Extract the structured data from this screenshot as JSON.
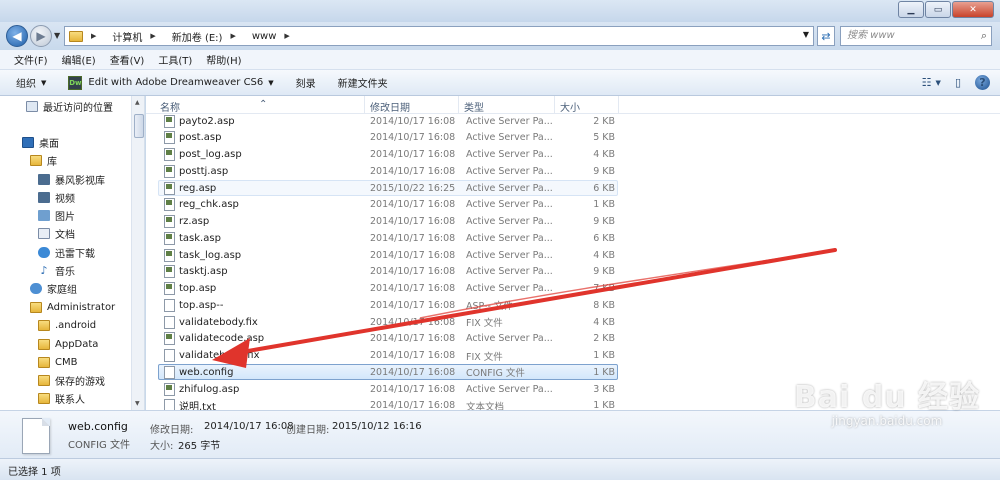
{
  "window": {
    "minimize_glyph": "▁",
    "maximize_glyph": "▭",
    "close_glyph": "✕"
  },
  "address": {
    "crumbs": [
      "计算机",
      "新加卷 (E:)",
      "www"
    ],
    "search_placeholder": "搜索 www"
  },
  "menu": [
    "文件(F)",
    "编辑(E)",
    "查看(V)",
    "工具(T)",
    "帮助(H)"
  ],
  "toolbar": {
    "organize": "组织",
    "dreamweaver": "Edit with Adobe Dreamweaver CS6",
    "dw_icon_text": "Dw",
    "burn": "刻录",
    "new_folder": "新建文件夹"
  },
  "nav": [
    {
      "label": "最近访问的位置",
      "icon": "recent-icon",
      "indent": 0
    },
    {
      "label": "桌面",
      "icon": "desktop-icon",
      "indent": 0
    },
    {
      "label": "库",
      "icon": "library-icon",
      "indent": 1
    },
    {
      "label": "暴风影视库",
      "icon": "video-library-icon",
      "indent": 2
    },
    {
      "label": "视频",
      "icon": "video-icon",
      "indent": 2
    },
    {
      "label": "图片",
      "icon": "pictures-icon",
      "indent": 2
    },
    {
      "label": "文档",
      "icon": "documents-icon",
      "indent": 2
    },
    {
      "label": "迅雷下载",
      "icon": "download-icon",
      "indent": 2
    },
    {
      "label": "音乐",
      "icon": "music-icon",
      "indent": 2
    },
    {
      "label": "家庭组",
      "icon": "homegroup-icon",
      "indent": 1
    },
    {
      "label": "Administrator",
      "icon": "user-folder-icon",
      "indent": 1
    },
    {
      "label": ".android",
      "icon": "folder-icon",
      "indent": 2
    },
    {
      "label": "AppData",
      "icon": "folder-icon",
      "indent": 2
    },
    {
      "label": "CMB",
      "icon": "folder-icon",
      "indent": 2
    },
    {
      "label": "保存的游戏",
      "icon": "folder-icon",
      "indent": 2
    },
    {
      "label": "联系人",
      "icon": "folder-icon",
      "indent": 2
    }
  ],
  "columns": {
    "name": "名称",
    "date": "修改日期",
    "type": "类型",
    "size": "大小"
  },
  "files": [
    {
      "name": "payto2.asp",
      "date": "2014/10/17 16:08",
      "type": "Active Server Pa...",
      "size": "2 KB",
      "kind": "asp"
    },
    {
      "name": "post.asp",
      "date": "2014/10/17 16:08",
      "type": "Active Server Pa...",
      "size": "5 KB",
      "kind": "asp"
    },
    {
      "name": "post_log.asp",
      "date": "2014/10/17 16:08",
      "type": "Active Server Pa...",
      "size": "4 KB",
      "kind": "asp"
    },
    {
      "name": "posttj.asp",
      "date": "2014/10/17 16:08",
      "type": "Active Server Pa...",
      "size": "9 KB",
      "kind": "asp"
    },
    {
      "name": "reg.asp",
      "date": "2015/10/22 16:25",
      "type": "Active Server Pa...",
      "size": "6 KB",
      "kind": "asp",
      "state": "hover"
    },
    {
      "name": "reg_chk.asp",
      "date": "2014/10/17 16:08",
      "type": "Active Server Pa...",
      "size": "1 KB",
      "kind": "asp"
    },
    {
      "name": "rz.asp",
      "date": "2014/10/17 16:08",
      "type": "Active Server Pa...",
      "size": "9 KB",
      "kind": "asp"
    },
    {
      "name": "task.asp",
      "date": "2014/10/17 16:08",
      "type": "Active Server Pa...",
      "size": "6 KB",
      "kind": "asp"
    },
    {
      "name": "task_log.asp",
      "date": "2014/10/17 16:08",
      "type": "Active Server Pa...",
      "size": "4 KB",
      "kind": "asp"
    },
    {
      "name": "tasktj.asp",
      "date": "2014/10/17 16:08",
      "type": "Active Server Pa...",
      "size": "9 KB",
      "kind": "asp"
    },
    {
      "name": "top.asp",
      "date": "2014/10/17 16:08",
      "type": "Active Server Pa...",
      "size": "7 KB",
      "kind": "asp"
    },
    {
      "name": "top.asp--",
      "date": "2014/10/17 16:08",
      "type": "ASP-- 文件",
      "size": "8 KB",
      "kind": "blank"
    },
    {
      "name": "validatebody.fix",
      "date": "2014/10/17 16:08",
      "type": "FIX 文件",
      "size": "4 KB",
      "kind": "blank"
    },
    {
      "name": "validatecode.asp",
      "date": "2014/10/17 16:08",
      "type": "Active Server Pa...",
      "size": "2 KB",
      "kind": "asp"
    },
    {
      "name": "validatehead.fix",
      "date": "2014/10/17 16:08",
      "type": "FIX 文件",
      "size": "1 KB",
      "kind": "blank"
    },
    {
      "name": "web.config",
      "date": "2014/10/17 16:08",
      "type": "CONFIG 文件",
      "size": "1 KB",
      "kind": "blank",
      "state": "sel"
    },
    {
      "name": "zhifulog.asp",
      "date": "2014/10/17 16:08",
      "type": "Active Server Pa...",
      "size": "3 KB",
      "kind": "asp"
    },
    {
      "name": "说明.txt",
      "date": "2014/10/17 16:08",
      "type": "文本文档",
      "size": "1 KB",
      "kind": "blank"
    }
  ],
  "details": {
    "name": "web.config",
    "type": "CONFIG 文件",
    "modified_label": "修改日期:",
    "modified_value": "2014/10/17 16:08",
    "created_label": "创建日期:",
    "created_value": "2015/10/12 16:16",
    "size_label": "大小:",
    "size_value": "265 字节"
  },
  "status": "已选择 1 项",
  "watermark": {
    "line1": "Bai du 经验",
    "line2": "jingyan.baidu.com"
  },
  "colors": {
    "annotation_arrow": "#e0342c",
    "selection_border": "#7da2ce"
  }
}
